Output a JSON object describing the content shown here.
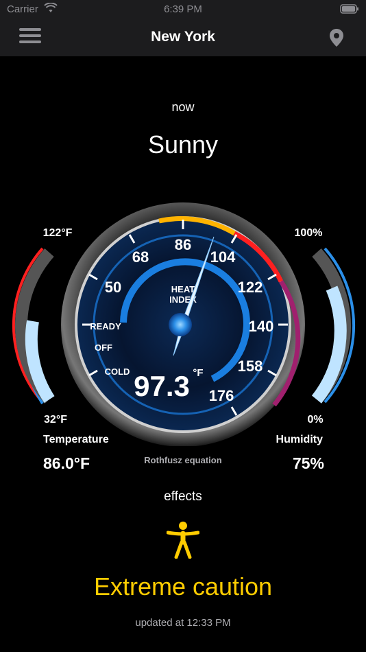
{
  "status": {
    "carrier": "Carrier",
    "time": "6:39 PM"
  },
  "nav": {
    "title": "New York"
  },
  "weather": {
    "time_label": "now",
    "condition": "Sunny"
  },
  "gauge": {
    "title_line1": "HEAT",
    "title_line2": "INDEX",
    "value": "97.3",
    "unit": "°F",
    "scale_labels": [
      "68",
      "86",
      "104",
      "50",
      "122",
      "140",
      "158",
      "176"
    ],
    "zone_labels": [
      "READY",
      "OFF",
      "COLD"
    ],
    "equation": "Rothfusz equation"
  },
  "temperature": {
    "max_label": "122°F",
    "min_label": "32°F",
    "label": "Temperature",
    "value": "86.0°F",
    "fill_fraction": 0.6
  },
  "humidity": {
    "max_label": "100%",
    "min_label": "0%",
    "label": "Humidity",
    "value": "75%",
    "fill_fraction": 0.75
  },
  "effects": {
    "label": "effects",
    "level": "Extreme caution"
  },
  "updated": "updated at 12:33 PM",
  "colors": {
    "accent": "#ffcc00",
    "gauge_blue": "#1e90ff",
    "danger": "#ff2020",
    "magenta": "#a0206e"
  }
}
